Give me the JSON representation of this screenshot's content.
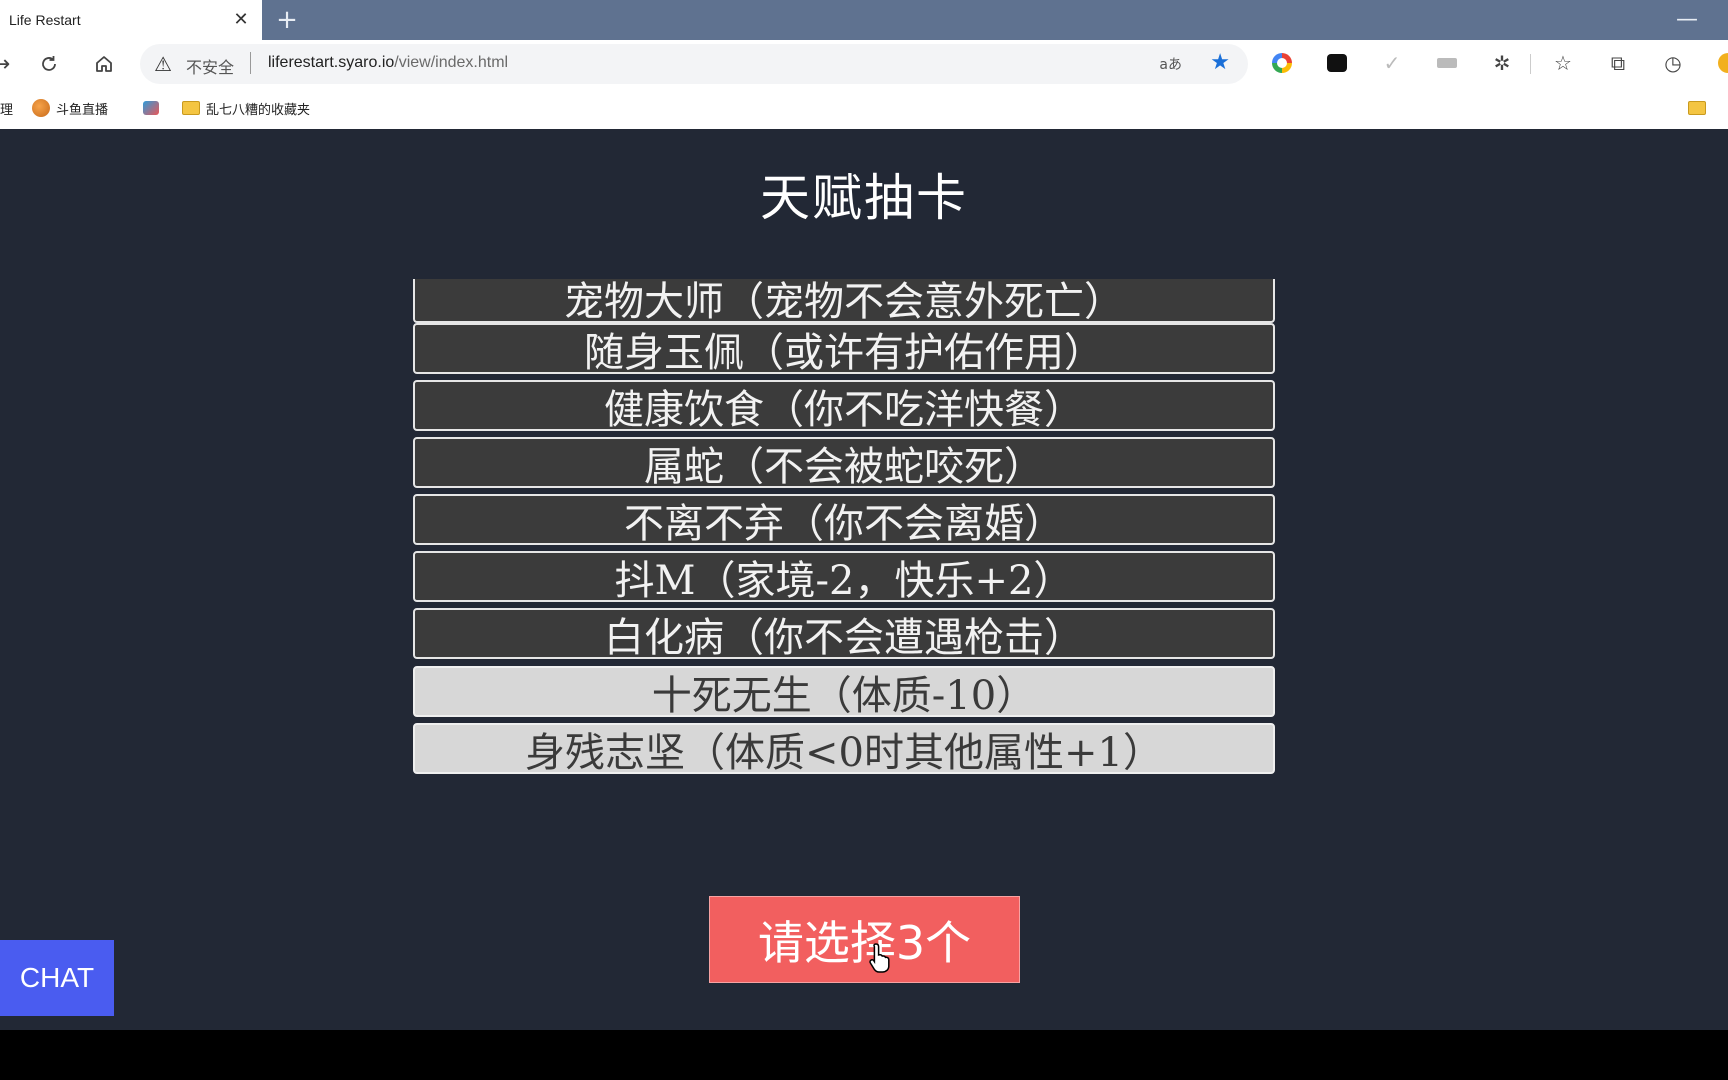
{
  "browser": {
    "tab_title": "Life Restart",
    "tab_close": "✕",
    "new_tab": "+",
    "minimize": "—",
    "security_label": "不安全",
    "url_host": "liferestart.syaro.io",
    "url_path": "/view/index.html",
    "read_aloud": "aあ",
    "bookmarks": [
      {
        "label": "理"
      },
      {
        "label": "斗鱼直播"
      },
      {
        "label": ""
      },
      {
        "label": "乱七八糟的收藏夹"
      }
    ]
  },
  "page": {
    "title": "天赋抽卡",
    "talents": [
      {
        "label": "宠物大师（宠物不会意外死亡）",
        "style": "dark"
      },
      {
        "label": "随身玉佩（或许有护佑作用）",
        "style": "dark"
      },
      {
        "label": "健康饮食（你不吃洋快餐）",
        "style": "dark"
      },
      {
        "label": "属蛇（不会被蛇咬死）",
        "style": "dark"
      },
      {
        "label": "不离不弃（你不会离婚）",
        "style": "dark"
      },
      {
        "label": "抖M（家境-2，快乐+2）",
        "style": "dark"
      },
      {
        "label": "白化病（你不会遭遇枪击）",
        "style": "dark"
      },
      {
        "label": "十死无生（体质-10）",
        "style": "grey"
      },
      {
        "label": "身残志坚（体质<0时其他属性+1）",
        "style": "grey"
      }
    ],
    "start_button": "请选择3个",
    "chat_button": "CHAT"
  },
  "colors": {
    "page_bg": "#222835",
    "talent_dark": "#3b3b3b",
    "talent_grey": "#d7d7d7",
    "start_button": "#f25f5f",
    "chat_button": "#4a5cf0"
  }
}
